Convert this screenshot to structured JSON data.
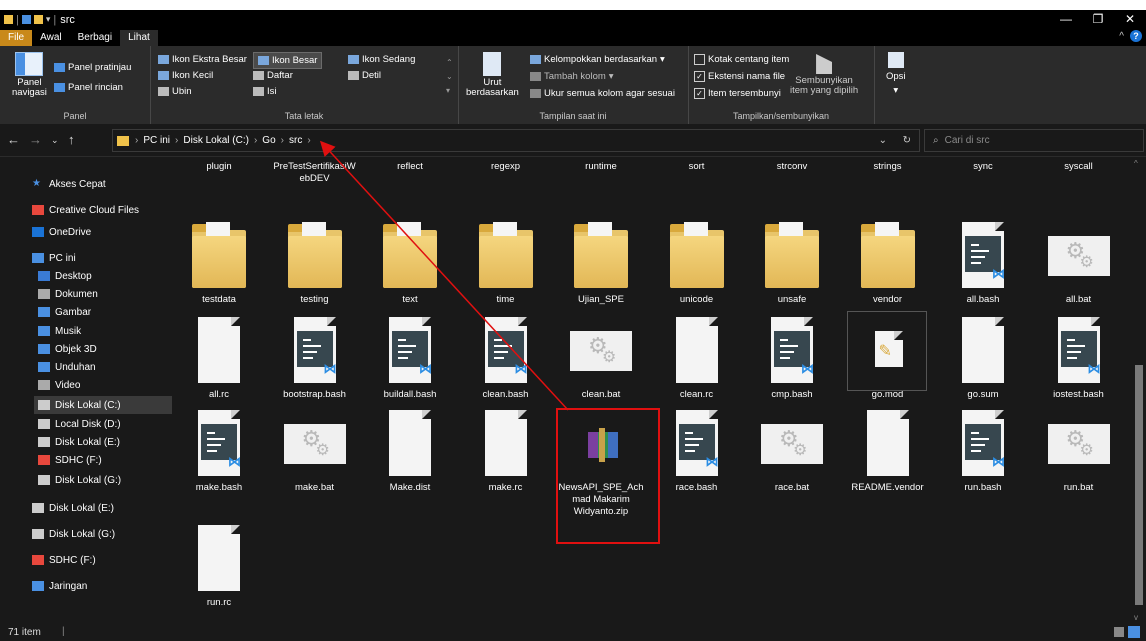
{
  "title_path": "src",
  "window_buttons": [
    "—",
    "❐",
    "✕"
  ],
  "tabs": [
    {
      "label": "File"
    },
    {
      "label": "Awal"
    },
    {
      "label": "Berbagi"
    },
    {
      "label": "Lihat"
    }
  ],
  "ribbon": {
    "panel": {
      "navigation_pane_lines": [
        "Panel",
        "navigasi"
      ],
      "preview_pane": "Panel pratinjau",
      "details_pane": "Panel rincian",
      "group_label": "Panel"
    },
    "layout": {
      "options": [
        "Ikon Ekstra Besar",
        "Ikon Besar",
        "Ikon Sedang",
        "Ikon Kecil",
        "Daftar",
        "Detil",
        "Ubin",
        "Isi"
      ],
      "selected": "Ikon Besar",
      "group_label": "Tata letak"
    },
    "current_view": {
      "sort_by_lines": [
        "Urut",
        "berdasarkan"
      ],
      "group_by": "Kelompokkan berdasarkan",
      "add_columns": "Tambah kolom",
      "size_columns": "Ukur semua kolom agar sesuai",
      "group_label": "Tampilan saat ini"
    },
    "show_hide": {
      "item_checkboxes": "Kotak centang item",
      "file_extensions": "Ekstensi nama file",
      "hidden_items": "Item tersembunyi",
      "hide_selected_lines": [
        "Sembunyikan",
        "item yang dipilih"
      ],
      "group_label": "Tampilkan/sembunyikan"
    },
    "options_label": "Opsi"
  },
  "address": {
    "crumbs": [
      "PC ini",
      "Disk Lokal (C:)",
      "Go",
      "src"
    ],
    "search_placeholder": "Cari di src"
  },
  "sidebar": {
    "items": [
      {
        "label": "Akses Cepat"
      },
      {
        "label": "Creative Cloud Files"
      },
      {
        "label": "OneDrive"
      },
      {
        "label": "PC ini"
      },
      {
        "label": "Desktop"
      },
      {
        "label": "Dokumen"
      },
      {
        "label": "Gambar"
      },
      {
        "label": "Musik"
      },
      {
        "label": "Objek 3D"
      },
      {
        "label": "Unduhan"
      },
      {
        "label": "Video"
      },
      {
        "label": "Disk Lokal (C:)"
      },
      {
        "label": "Local Disk (D:)"
      },
      {
        "label": "Disk Lokal (E:)"
      },
      {
        "label": "SDHC (F:)"
      },
      {
        "label": "Disk Lokal (G:)"
      },
      {
        "label": "Disk Lokal (E:)"
      },
      {
        "label": "Disk Lokal (G:)"
      },
      {
        "label": "SDHC (F:)"
      },
      {
        "label": "Jaringan"
      }
    ]
  },
  "files": [
    {
      "name": "plugin",
      "type": "folder"
    },
    {
      "name": "PreTestSertifikasiWebDEV",
      "type": "folder"
    },
    {
      "name": "reflect",
      "type": "folder"
    },
    {
      "name": "regexp",
      "type": "folder"
    },
    {
      "name": "runtime",
      "type": "folder"
    },
    {
      "name": "sort",
      "type": "folder"
    },
    {
      "name": "strconv",
      "type": "folder"
    },
    {
      "name": "strings",
      "type": "folder"
    },
    {
      "name": "sync",
      "type": "folder"
    },
    {
      "name": "syscall",
      "type": "folder"
    },
    {
      "name": "testdata",
      "type": "folder"
    },
    {
      "name": "testing",
      "type": "folder"
    },
    {
      "name": "text",
      "type": "folder"
    },
    {
      "name": "time",
      "type": "folder"
    },
    {
      "name": "Ujian_SPE",
      "type": "folder"
    },
    {
      "name": "unicode",
      "type": "folder"
    },
    {
      "name": "unsafe",
      "type": "folder"
    },
    {
      "name": "vendor",
      "type": "folder"
    },
    {
      "name": "all.bash",
      "type": "vscode"
    },
    {
      "name": "all.bat",
      "type": "bat"
    },
    {
      "name": "all.rc",
      "type": "blank"
    },
    {
      "name": "bootstrap.bash",
      "type": "vscode"
    },
    {
      "name": "buildall.bash",
      "type": "vscode"
    },
    {
      "name": "clean.bash",
      "type": "vscode"
    },
    {
      "name": "clean.bat",
      "type": "bat"
    },
    {
      "name": "clean.rc",
      "type": "blank"
    },
    {
      "name": "cmp.bash",
      "type": "vscode"
    },
    {
      "name": "go.mod",
      "type": "mod"
    },
    {
      "name": "go.sum",
      "type": "blank"
    },
    {
      "name": "iostest.bash",
      "type": "vscode"
    },
    {
      "name": "make.bash",
      "type": "vscode"
    },
    {
      "name": "make.bat",
      "type": "bat"
    },
    {
      "name": "Make.dist",
      "type": "blank"
    },
    {
      "name": "make.rc",
      "type": "blank"
    },
    {
      "name": "NewsAPI_SPE_Achmad Makarim Widyanto.zip",
      "type": "zip"
    },
    {
      "name": "race.bash",
      "type": "vscode"
    },
    {
      "name": "race.bat",
      "type": "bat"
    },
    {
      "name": "README.vendor",
      "type": "blank"
    },
    {
      "name": "run.bash",
      "type": "vscode"
    },
    {
      "name": "run.bat",
      "type": "bat"
    },
    {
      "name": "run.rc",
      "type": "blank"
    }
  ],
  "status": {
    "item_count": "71 item"
  },
  "colors": {
    "highlight": "#e01010",
    "accent": "#0078d7"
  }
}
